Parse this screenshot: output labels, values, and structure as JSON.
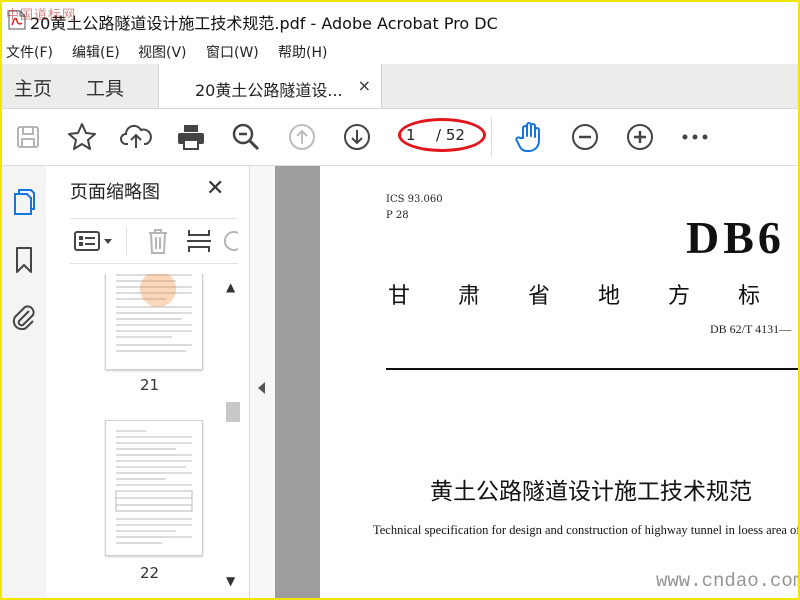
{
  "window": {
    "title": "20黄土公路隧道设计施工技术规范.pdf - Adobe Acrobat Pro DC",
    "watermark_top": "中国道标网",
    "watermark_bottom": "www.cndao.com"
  },
  "menu": {
    "items": [
      "文件(F)",
      "编辑(E)",
      "视图(V)",
      "窗口(W)",
      "帮助(H)"
    ]
  },
  "tabs": {
    "home": "主页",
    "tools": "工具",
    "document": "20黄土公路隧道设...",
    "close": "×"
  },
  "toolbar": {
    "icons": [
      "save-icon",
      "bookmark-star-icon",
      "upload-icon",
      "print-icon",
      "zoom-search-icon",
      "page-up-icon",
      "page-down-icon",
      "hand-tool-icon",
      "zoom-out-icon",
      "zoom-in-icon",
      "more-icon"
    ],
    "current_page": "1",
    "page_total": "/ 52",
    "accent_color": "#1473e6",
    "annotation_color": "#e3161d"
  },
  "left_rail": {
    "icons": [
      "page-thumbnails-icon",
      "bookmarks-icon",
      "attachments-icon"
    ]
  },
  "thumbnail_panel": {
    "title": "页面缩略图",
    "close": "✕",
    "pages": [
      {
        "number": "21"
      },
      {
        "number": "22"
      }
    ]
  },
  "document": {
    "ics": "ICS    93.060",
    "p_code": "P  28",
    "db_header": "DB6",
    "province_chars": [
      "甘",
      "肃",
      "省",
      "地",
      "方",
      "标"
    ],
    "standard_number": "DB 62/T  4131—",
    "title_cn": "黄土公路隧道设计施工技术规范",
    "title_en": "Technical specification for design and construction of highway tunnel in loess area of"
  }
}
